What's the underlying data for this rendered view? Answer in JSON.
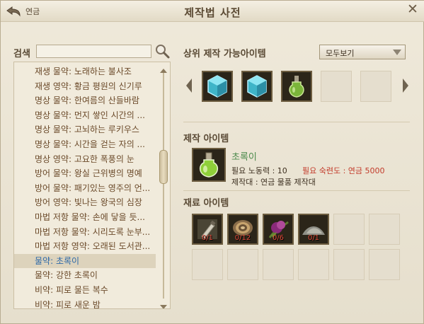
{
  "window": {
    "title": "제작법 사전",
    "back_label": "연금",
    "close_glyph": "✕"
  },
  "search": {
    "label": "검색",
    "value": "",
    "placeholder": ""
  },
  "recipe_list": {
    "items": [
      "재생 물약: 노래하는 불사조",
      "재생 영약: 황금 평원의 신기루",
      "명상 물약: 한여름의 산들바람",
      "명상 물약: 먼지 쌓인 시간의 ...",
      "명상 물약: 고뇌하는 루키우스",
      "명상 물약: 시간을 걷는 자의 ...",
      "명상 영약: 고요한 폭풍의 눈",
      "방어 물약: 왕실 근위병의 명예",
      "방어 물약: 패기있는 영주의 언...",
      "방어 영약: 빛나는 왕국의 심장",
      "마법 저항 물약: 손에 닿을 듯...",
      "마법 저항 물약: 시리도록 눈부...",
      "마법 저항 영약: 오래된 도서관...",
      "물약: 초록이",
      "물약: 강한 초록이",
      "비약: 피로 물든 복수",
      "비약: 피로 새운 밤"
    ],
    "selected_index": 13,
    "scroll_position": 0.35
  },
  "upper_items": {
    "title": "상위 제작 가능아이템",
    "filter_value": "모두보기",
    "slots": [
      {
        "icon": "blue-crystal-icon",
        "filled": true
      },
      {
        "icon": "blue-crystal-icon",
        "filled": true
      },
      {
        "icon": "green-potion-icon",
        "filled": true
      },
      {
        "filled": false
      },
      {
        "filled": false
      }
    ]
  },
  "craft_item": {
    "section_title": "제작 아이템",
    "name": "초록이",
    "icon": "green-potion-flask-icon",
    "labor_label": "필요 노동력 : 10",
    "skill_label": "필요 숙련도 : 연금 5000",
    "station_label": "제작대 : 연금 물품 제작대"
  },
  "materials": {
    "section_title": "재료 아이템",
    "slots": [
      {
        "icon": "empty-vial-icon",
        "count": "0/1"
      },
      {
        "icon": "snail-shell-icon",
        "count": "0/12"
      },
      {
        "icon": "thistle-flower-icon",
        "count": "0/6"
      },
      {
        "icon": "powder-pile-icon",
        "count": "0/1"
      }
    ],
    "empty_slot_count": 8
  },
  "colors": {
    "accent_red": "#c23a2a",
    "item_green": "#4c8a4c",
    "selected_blue": "#2d68a8",
    "list_text": "#6b4a2a"
  }
}
